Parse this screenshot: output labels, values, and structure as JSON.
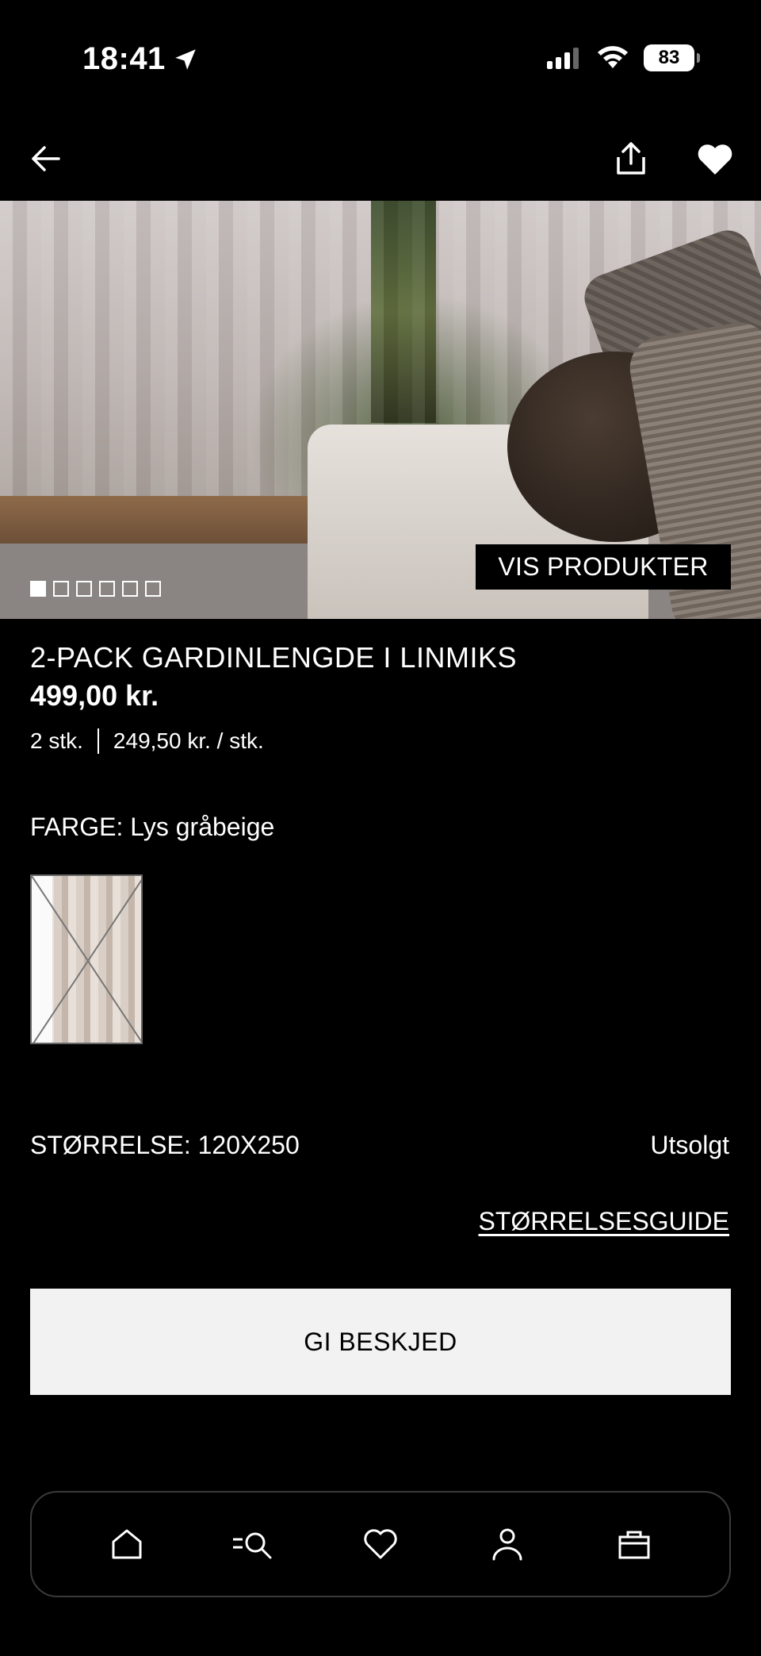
{
  "status_bar": {
    "time": "18:41",
    "battery": "83"
  },
  "nav": {
    "back_icon": "arrow-left-icon",
    "share_icon": "share-icon",
    "favorite_icon": "heart-filled-icon"
  },
  "hero": {
    "button_label": "VIS PRODUKTER",
    "slide_count": 6,
    "active_slide": 1
  },
  "product": {
    "title": "2-PACK GARDINLENGDE I LINMIKS",
    "price": "499,00 kr.",
    "quantity": "2 stk.",
    "unit_price": "249,50 kr. / stk."
  },
  "color": {
    "label": "FARGE: Lys gråbeige"
  },
  "size": {
    "label": "STØRRELSE: 120X250",
    "availability": "Utsolgt",
    "guide_label": "STØRRELSESGUIDE"
  },
  "cta": {
    "label": "GI BESKJED"
  },
  "tabbar": {
    "items": [
      "home-icon",
      "search-menu-icon",
      "heart-icon",
      "account-icon",
      "bag-icon"
    ]
  },
  "colors": {
    "background": "#000000",
    "cta_background": "#f2f2f2",
    "text": "#ffffff"
  }
}
